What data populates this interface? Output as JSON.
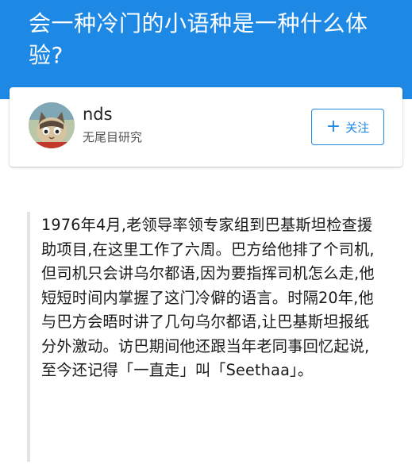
{
  "question": {
    "title": "会一种冷门的小语种是一种什么体验?"
  },
  "author": {
    "name": "nds",
    "bio": "无尾目研究",
    "follow_label": "关注",
    "follow_icon": "plus-icon",
    "avatar_icon": "cat-avatar"
  },
  "answer": {
    "text": "1976年4月,老领导率领专家组到巴基斯坦检查援助项目,在这里工作了六周。巴方给他排了个司机,但司机只会讲乌尔都语,因为要指挥司机怎么走,他短短时间内掌握了这门冷僻的语言。时隔20年,他与巴方会晤时讲了几句乌尔都语,让巴基斯坦报纸分外激动。访巴期间他还跟当年老同事回忆起说,至今还记得「一直走」叫「Seethaa」。"
  },
  "colors": {
    "header_bg": "#1e88e5",
    "accent": "#1e88e5",
    "quote_border": "#e4e4e4"
  }
}
